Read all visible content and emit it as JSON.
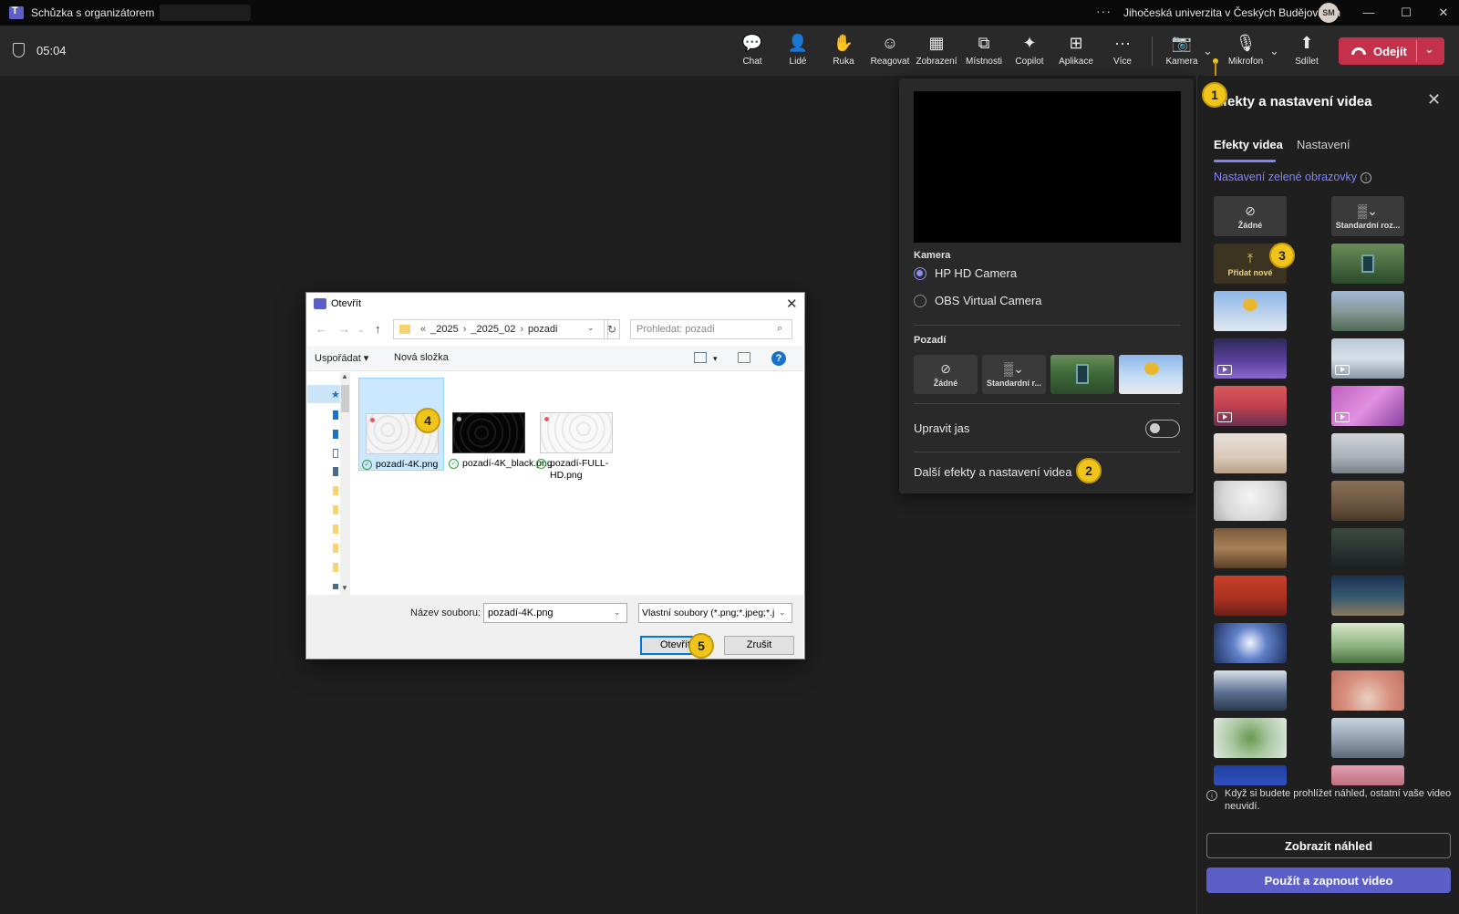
{
  "titlebar": {
    "title": "Schůzka s organizátorem",
    "more": "···",
    "org": "Jihočeská univerzita v Českých Budějovicích",
    "avatar": "SM",
    "minimize": "—",
    "maximize": "☐",
    "close": "✕"
  },
  "meeting": {
    "timer": "05:04",
    "buttons": [
      {
        "label": "Chat",
        "icon": "chat-icon",
        "glyph": "💬"
      },
      {
        "label": "Lidé",
        "icon": "people-icon",
        "glyph": "👤"
      },
      {
        "label": "Ruka",
        "icon": "raise-hand-icon",
        "glyph": "✋"
      },
      {
        "label": "Reagovat",
        "icon": "react-icon",
        "glyph": "☺"
      },
      {
        "label": "Zobrazení",
        "icon": "view-icon",
        "glyph": "▦"
      },
      {
        "label": "Místnosti",
        "icon": "rooms-icon",
        "glyph": "⧉"
      },
      {
        "label": "Copilot",
        "icon": "copilot-icon",
        "glyph": "✦"
      },
      {
        "label": "Aplikace",
        "icon": "apps-icon",
        "glyph": "⊞"
      },
      {
        "label": "Více",
        "icon": "more-icon",
        "glyph": "···"
      },
      {
        "label": "Kamera",
        "icon": "camera-off-icon",
        "glyph": "📷"
      },
      {
        "label": "Mikrofon",
        "icon": "mic-off-icon",
        "glyph": "🎙"
      },
      {
        "label": "Sdílet",
        "icon": "share-icon",
        "glyph": "⬆"
      }
    ],
    "chevron": "⌄",
    "leave_label": "Odejít"
  },
  "markers": [
    "1",
    "2",
    "3",
    "4",
    "5"
  ],
  "camera_popup": {
    "camera_section": "Kamera",
    "cameras": [
      {
        "label": "HP HD Camera",
        "selected": true
      },
      {
        "label": "OBS Virtual Camera",
        "selected": false
      }
    ],
    "background_section": "Pozadí",
    "bg_none": "Žádné",
    "bg_blur": "Standardní r...",
    "brightness_label": "Upravit jas",
    "brightness_on": false,
    "more_effects": "Další efekty a nastavení videa"
  },
  "effects_panel": {
    "title": "Efekty a nastavení videa",
    "close": "✕",
    "tabs": [
      "Efekty videa",
      "Nastavení"
    ],
    "active_tab": "Efekty videa",
    "green_screen": "Nastavení zelené obrazovky",
    "info": "i",
    "none_label": "Žádné",
    "blur_label": "Standardní roz...",
    "add_label": "Přidat nové",
    "notice": "Když si budete prohlížet náhled, ostatní vaše video neuvidí.",
    "preview_button": "Zobrazit náhled",
    "apply_button": "Použít a zapnout video"
  },
  "file_dialog": {
    "title": "Otevřít",
    "close": "✕",
    "breadcrumb": [
      "«",
      "_2025",
      "›",
      "_2025_02",
      "›",
      "pozadi"
    ],
    "search_placeholder": "Prohledat: pozadi",
    "organize": "Uspořádat ▾",
    "new_folder": "Nová složka",
    "help": "?",
    "files": [
      {
        "name": "pozadí-4K.png",
        "selected": true
      },
      {
        "name": "pozadí-4K_black.png",
        "selected": false
      },
      {
        "name": "pozadí-FULL-HD.png",
        "selected": false
      }
    ],
    "filename_label": "Název souboru:",
    "filename_value": "pozadí-4K.png",
    "filetype_value": "Vlastní soubory (*.png;*.jpeg;*.j",
    "open_button": "Otevřít",
    "cancel_button": "Zrušit"
  },
  "colors": {
    "accent": "#5b5fc7",
    "leave": "#c4314b",
    "marker": "#f0c419"
  }
}
